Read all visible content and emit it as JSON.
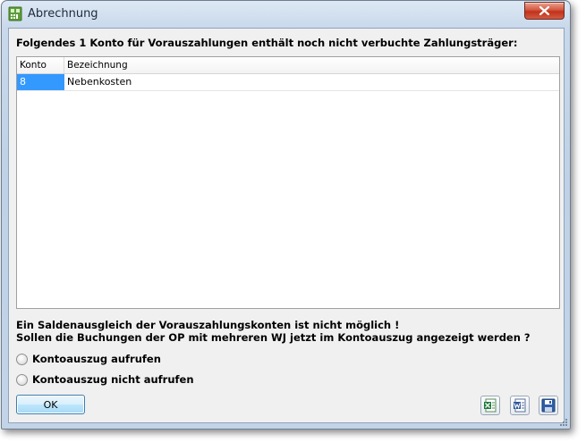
{
  "window": {
    "title": "Abrechnung",
    "icon": "app-calculator-icon",
    "close_icon": "close-icon"
  },
  "heading": "Folgendes 1 Konto für Vorauszahlungen enthält noch nicht verbuchte Zahlungsträger:",
  "table": {
    "columns": [
      "Konto",
      "Bezeichnung"
    ],
    "rows": [
      {
        "konto": "8",
        "bezeichnung": "Nebenkosten",
        "selected": true
      }
    ]
  },
  "message": {
    "line1": "Ein Saldenausgleich der Vorauszahlungskonten ist nicht möglich !",
    "line2": "Sollen die Buchungen der OP mit mehreren WJ jetzt im Kontoauszug angezeigt werden ?"
  },
  "options": [
    {
      "label": "Kontoauszug aufrufen",
      "checked": false
    },
    {
      "label": "Kontoauszug nicht aufrufen",
      "checked": false
    }
  ],
  "buttons": {
    "ok": "OK",
    "excel_icon": "excel-export-icon",
    "word_icon": "word-export-icon",
    "save_icon": "save-disk-icon"
  },
  "colors": {
    "selection": "#3399ff",
    "close_button": "#c7462e",
    "window_frame": "#c3d4e8"
  }
}
